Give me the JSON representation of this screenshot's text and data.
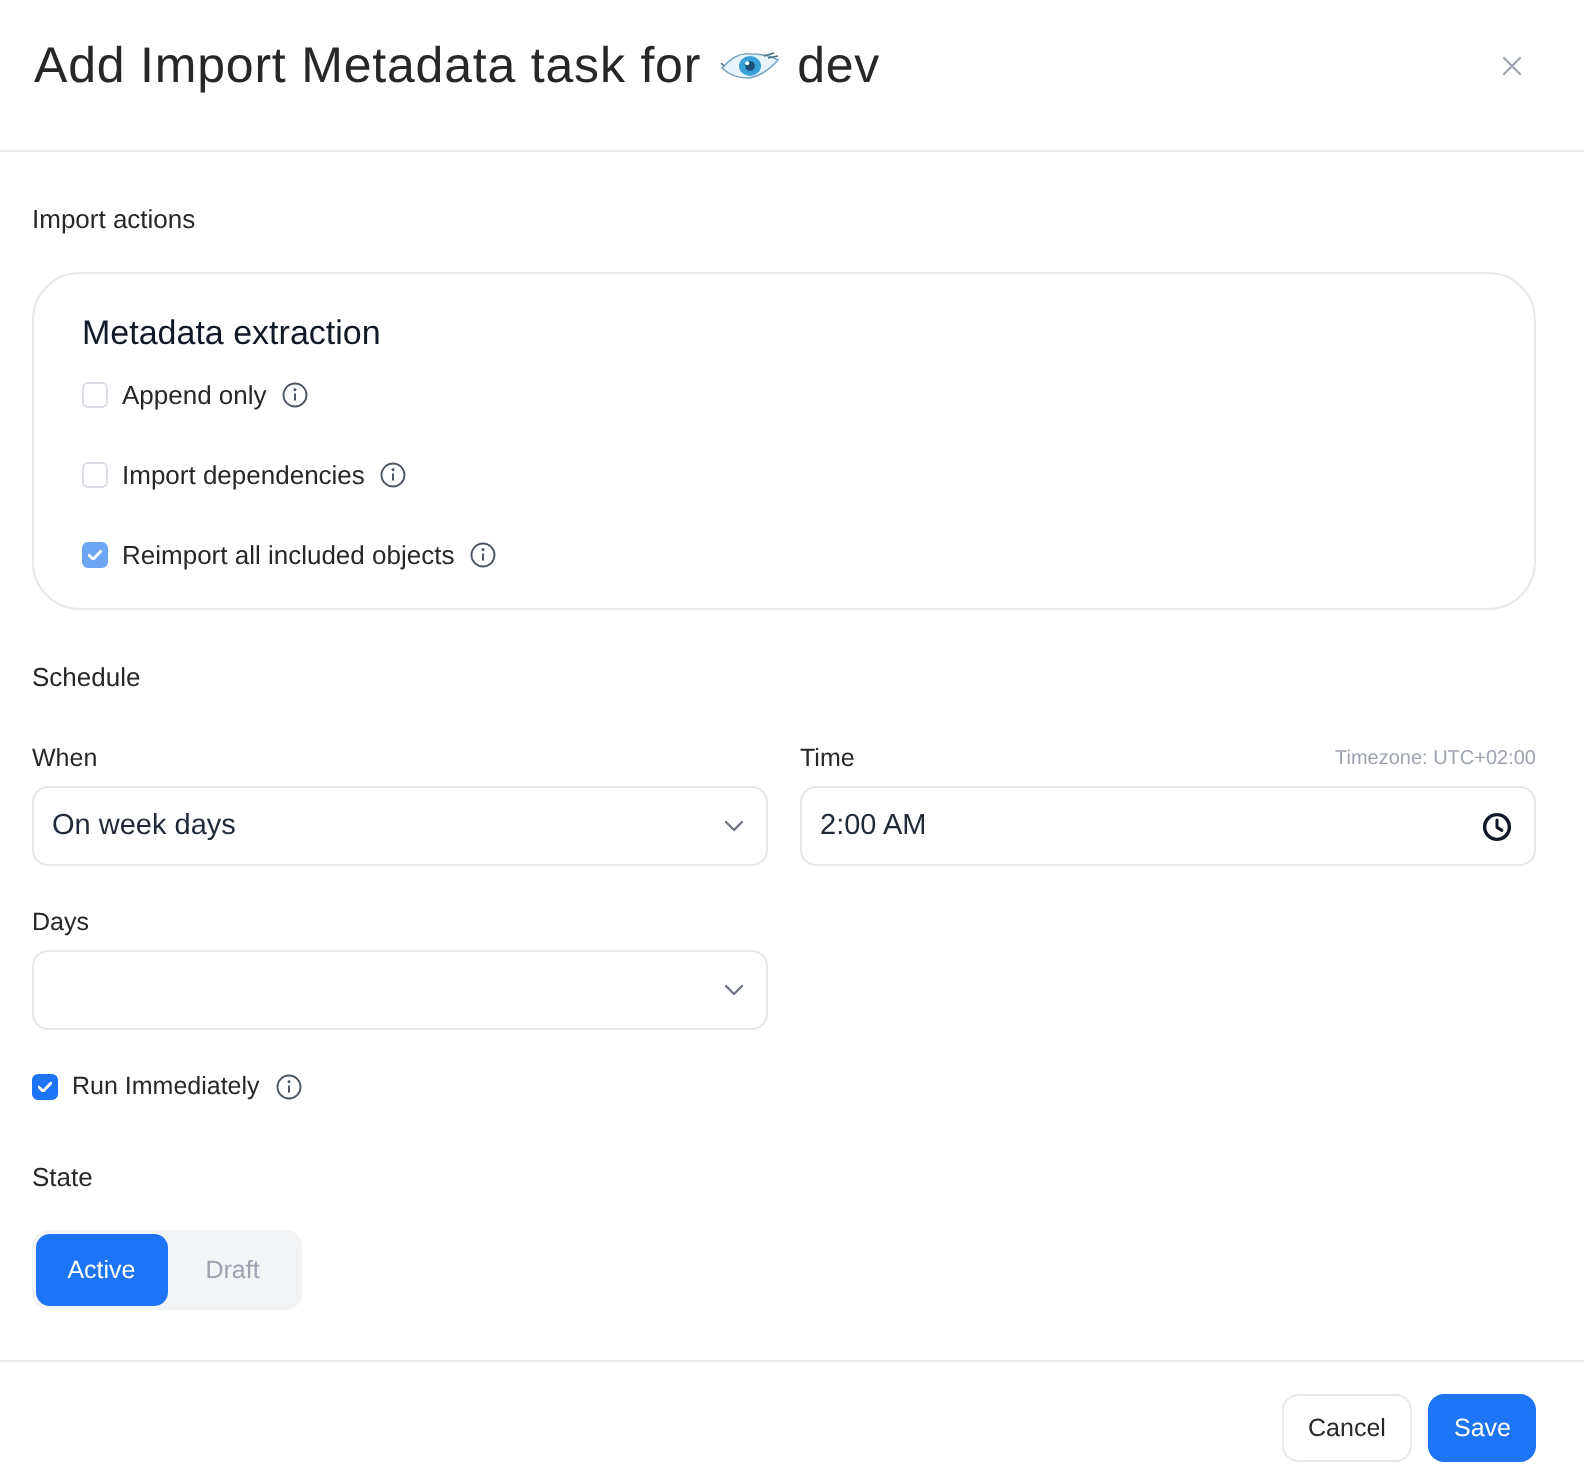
{
  "header": {
    "title": "Add Import Metadata task for",
    "source": "dev"
  },
  "import_actions": {
    "heading": "Import actions",
    "card_title": "Metadata extraction",
    "options": [
      {
        "label": "Append only",
        "checked": false,
        "disabled": false
      },
      {
        "label": "Import dependencies",
        "checked": false,
        "disabled": false
      },
      {
        "label": "Reimport all included objects",
        "checked": true,
        "disabled": true
      }
    ]
  },
  "schedule": {
    "heading": "Schedule",
    "when": {
      "label": "When",
      "value": "On week days"
    },
    "time": {
      "label": "Time",
      "timezone": "Timezone: UTC+02:00",
      "value": "2:00 AM"
    },
    "days": {
      "label": "Days"
    },
    "run_immediately": {
      "label": "Run Immediately",
      "checked": true
    }
  },
  "state": {
    "heading": "State",
    "options": [
      {
        "label": "Active",
        "selected": true
      },
      {
        "label": "Draft",
        "selected": false
      }
    ]
  },
  "footer": {
    "buttons": [
      {
        "label": "Cancel",
        "kind": "secondary"
      },
      {
        "label": "Save",
        "kind": "primary"
      }
    ]
  }
}
